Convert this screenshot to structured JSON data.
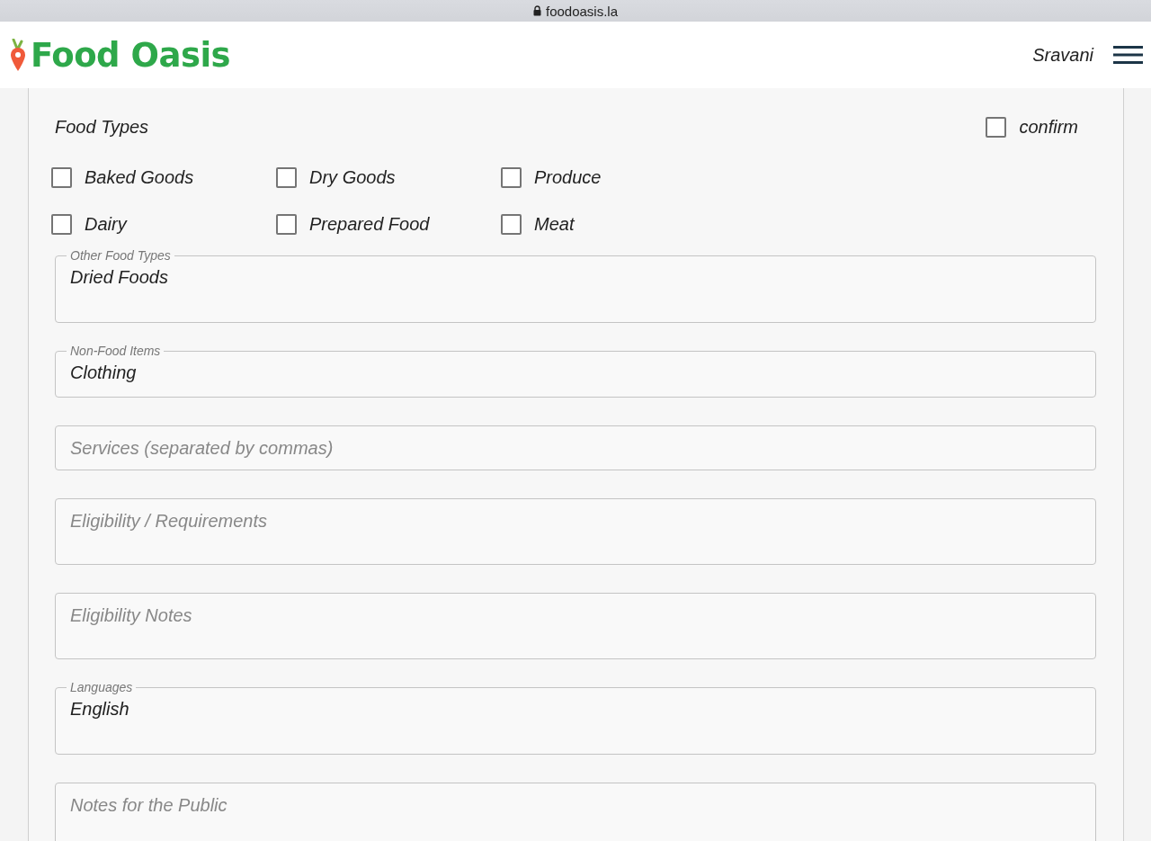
{
  "browser": {
    "address": "foodoasis.la"
  },
  "header": {
    "logo": "Food Oasis",
    "user": "Sravani"
  },
  "food_types": {
    "label": "Food Types",
    "confirm": {
      "label": "confirm",
      "checked": false
    },
    "options": [
      {
        "label": "Baked Goods",
        "checked": false
      },
      {
        "label": "Dry Goods",
        "checked": false
      },
      {
        "label": "Produce",
        "checked": false
      },
      {
        "label": "Dairy",
        "checked": false
      },
      {
        "label": "Prepared Food",
        "checked": false
      },
      {
        "label": "Meat",
        "checked": false
      }
    ]
  },
  "fields": [
    {
      "kind": "multiline",
      "label": "Other Food Types",
      "value": "Dried Foods"
    },
    {
      "kind": "single",
      "label": "Non-Food Items",
      "value": "Clothing"
    },
    {
      "kind": "single",
      "placeholder": "Services (separated by commas)"
    },
    {
      "kind": "multiline",
      "placeholder": "Eligibility / Requirements"
    },
    {
      "kind": "multiline",
      "placeholder": "Eligibility Notes"
    },
    {
      "kind": "multiline",
      "label": "Languages",
      "value": "English"
    },
    {
      "kind": "multiline",
      "placeholder": "Notes for the Public"
    }
  ]
}
